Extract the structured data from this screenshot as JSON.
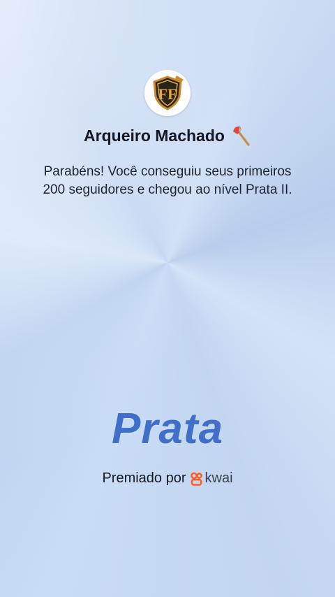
{
  "profile": {
    "name": "Arqueiro Machado",
    "name_emoji_icon": "axe-icon",
    "avatar_icon": "shield-emblem-icon"
  },
  "message": "Parabéns! Você conseguiu seus primeiros 200 seguidores e chegou ao nível Prata II.",
  "tier": {
    "label": "Prata",
    "color": "#3f6fc8"
  },
  "footer": {
    "awarded_by": "Premiado por",
    "brand_name": "kwai",
    "brand_icon": "kwai-logo-icon",
    "brand_color": "#ff5a1f"
  }
}
